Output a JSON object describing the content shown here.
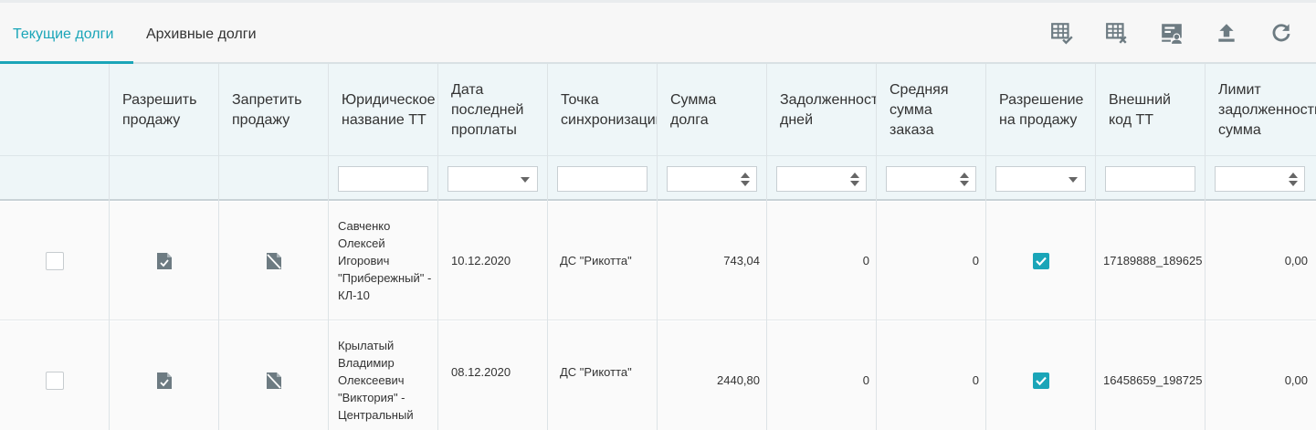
{
  "tabs": [
    {
      "label": "Текущие долги",
      "active": true
    },
    {
      "label": "Архивные долги",
      "active": false
    }
  ],
  "toolbar": {
    "icons": [
      "table-check-icon",
      "table-remove-icon",
      "user-card-icon",
      "upload-icon",
      "refresh-icon"
    ],
    "icon_color": "#6d7b82"
  },
  "accent_color": "#1aa5b8",
  "columns": [
    {
      "label": ""
    },
    {
      "label": "Разрешить\nпродажу"
    },
    {
      "label": "Запретить\nпродажу"
    },
    {
      "label": "Юридическое\nназвание ТТ"
    },
    {
      "label": "Дата\nпоследней\nпроплаты"
    },
    {
      "label": "Точка\nсинхронизации"
    },
    {
      "label": "Сумма\nдолга"
    },
    {
      "label": "Задолженность\nдней"
    },
    {
      "label": "Средняя\nсумма\nзаказа"
    },
    {
      "label": "Разрешение\nна продажу"
    },
    {
      "label": "Внешний\nкод ТТ"
    },
    {
      "label": "Лимит\nзадолженности\nсумма"
    }
  ],
  "rows": [
    {
      "selected": false,
      "legal_name": "Савченко Олексей Игорович \"Прибережный\" - КЛ-10",
      "last_payment_date": "10.12.2020",
      "sync_point": "ДС \"Рикотта\"",
      "debt_sum": "743,04",
      "debt_days": "0",
      "avg_order_sum": "0",
      "sale_allowed": true,
      "external_code": "17189888_189625",
      "debt_limit": "0,00"
    },
    {
      "selected": false,
      "legal_name": "Крылатый Владимир Олексеевич \"Виктория\" - Центральный",
      "last_payment_date": "08.12.2020",
      "sync_point": "ДС \"Рикотта\"",
      "debt_sum": "2440,80",
      "debt_days": "0",
      "avg_order_sum": "0",
      "sale_allowed": true,
      "external_code": "16458659_198725",
      "debt_limit": "0,00"
    }
  ]
}
